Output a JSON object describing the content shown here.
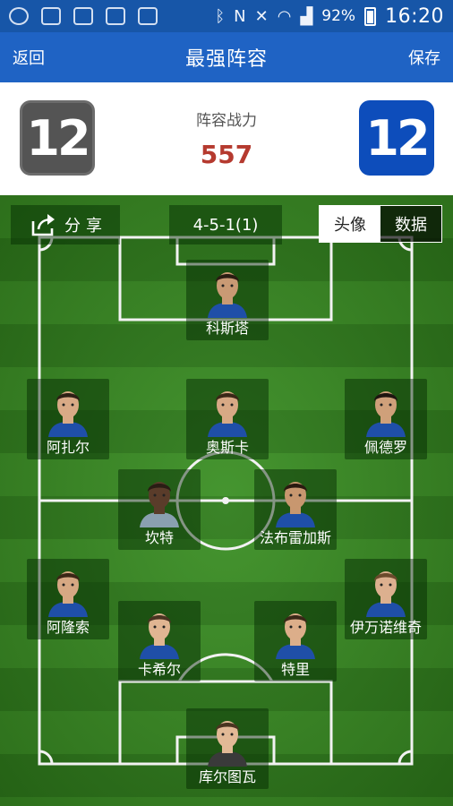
{
  "status_bar": {
    "battery": "92%",
    "time": "16:20"
  },
  "nav": {
    "back_label": "返回",
    "title": "最强阵容",
    "save_label": "保存"
  },
  "header": {
    "left_badge_number": "12",
    "right_badge_number": "12",
    "power_label": "阵容战力",
    "power_value": "557"
  },
  "pitch": {
    "share_label": "分享",
    "formation": "4-5-1(1)",
    "view_toggle": {
      "avatar_label": "头像",
      "data_label": "数据",
      "selected": "头像"
    }
  },
  "players": [
    {
      "name": "科斯塔",
      "shirt": "#1f4fa8",
      "skin": "#c99a74",
      "hair": "#2a1c12"
    },
    {
      "name": "阿扎尔",
      "shirt": "#1f4fa8",
      "skin": "#d9aa86",
      "hair": "#2d1f14"
    },
    {
      "name": "奥斯卡",
      "shirt": "#1f4fa8",
      "skin": "#d8a985",
      "hair": "#3a2717"
    },
    {
      "name": "佩德罗",
      "shirt": "#1f4fa8",
      "skin": "#cfa07a",
      "hair": "#1e1510"
    },
    {
      "name": "坎特",
      "shirt": "#8aa0b0",
      "skin": "#5a3c2a",
      "hair": "#2a1c14"
    },
    {
      "name": "法布雷加斯",
      "shirt": "#1f4fa8",
      "skin": "#c8976f",
      "hair": "#2a1a10"
    },
    {
      "name": "阿隆索",
      "shirt": "#1f4fa8",
      "skin": "#d6a883",
      "hair": "#3b2616"
    },
    {
      "name": "伊万诺维奇",
      "shirt": "#1f4fa8",
      "skin": "#dcb08f",
      "hair": "#6b4a2c"
    },
    {
      "name": "卡希尔",
      "shirt": "#1f4fa8",
      "skin": "#e0b592",
      "hair": "#4a3422"
    },
    {
      "name": "特里",
      "shirt": "#1f4fa8",
      "skin": "#dcae8a",
      "hair": "#3a2818"
    },
    {
      "name": "库尔图瓦",
      "shirt": "#3a3a3a",
      "skin": "#e2b996",
      "hair": "#4a3420"
    }
  ]
}
